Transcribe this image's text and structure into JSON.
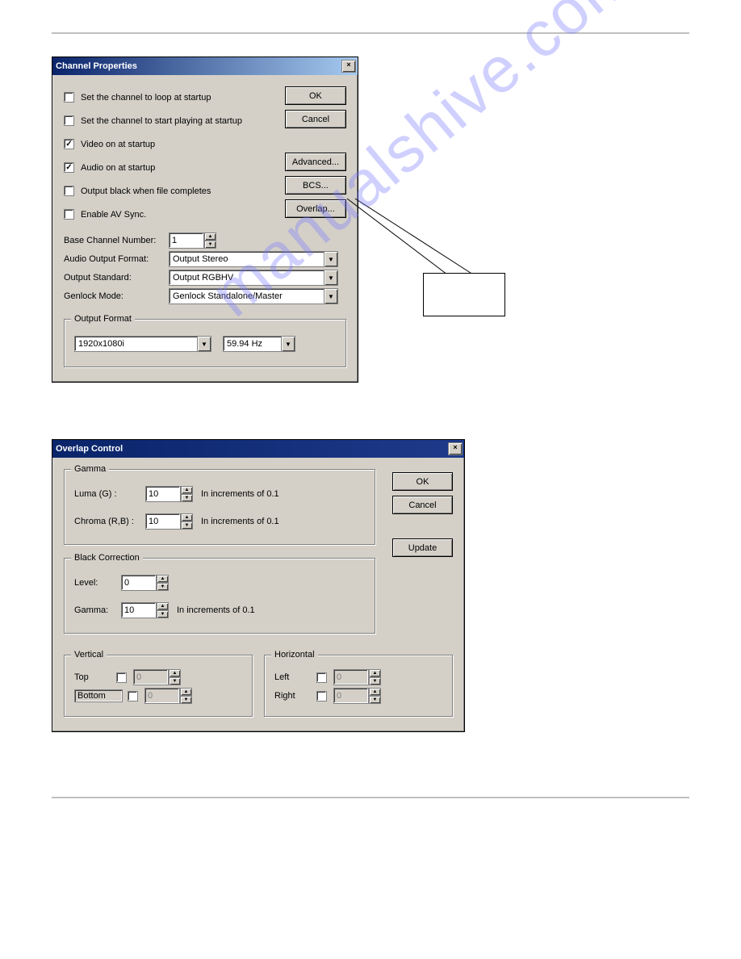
{
  "watermark": "manualshive.com",
  "channel_properties": {
    "title": "Channel Properties",
    "checkboxes": {
      "loop_startup": {
        "label": "Set the channel to loop at startup",
        "checked": false
      },
      "play_startup": {
        "label": "Set the channel to start playing at startup",
        "checked": false
      },
      "video_on": {
        "label": "Video on at startup",
        "checked": true
      },
      "audio_on": {
        "label": "Audio on at startup",
        "checked": true
      },
      "output_black": {
        "label": "Output black when file completes",
        "checked": false
      },
      "av_sync": {
        "label": "Enable AV Sync.",
        "checked": false
      }
    },
    "buttons": {
      "ok": "OK",
      "cancel": "Cancel",
      "advanced": "Advanced...",
      "bcs": "BCS...",
      "overlap": "Overlap..."
    },
    "fields": {
      "base_channel": {
        "label": "Base Channel Number:",
        "value": "1"
      },
      "audio_format": {
        "label": "Audio Output Format:",
        "value": "Output Stereo"
      },
      "output_standard": {
        "label": "Output Standard:",
        "value": "Output RGBHV"
      },
      "genlock": {
        "label": "Genlock Mode:",
        "value": "Genlock Standalone/Master"
      }
    },
    "output_format": {
      "legend": "Output Format",
      "resolution": "1920x1080i",
      "refresh": "59.94 Hz"
    }
  },
  "overlap_control": {
    "title": "Overlap Control",
    "buttons": {
      "ok": "OK",
      "cancel": "Cancel",
      "update": "Update"
    },
    "gamma": {
      "legend": "Gamma",
      "luma": {
        "label": "Luma (G) :",
        "value": "10",
        "hint": "In increments of 0.1"
      },
      "chroma": {
        "label": "Chroma (R,B) :",
        "value": "10",
        "hint": "In increments of 0.1"
      }
    },
    "black_correction": {
      "legend": "Black Correction",
      "level": {
        "label": "Level:",
        "value": "0"
      },
      "gamma": {
        "label": "Gamma:",
        "value": "10",
        "hint": "In increments of 0.1"
      }
    },
    "vertical": {
      "legend": "Vertical",
      "top": {
        "label": "Top",
        "value": "0",
        "checked": false
      },
      "bottom": {
        "label": "Bottom",
        "value": "0",
        "checked": false
      }
    },
    "horizontal": {
      "legend": "Horizontal",
      "left": {
        "label": "Left",
        "value": "0",
        "checked": false
      },
      "right": {
        "label": "Right",
        "value": "0",
        "checked": false
      }
    }
  }
}
